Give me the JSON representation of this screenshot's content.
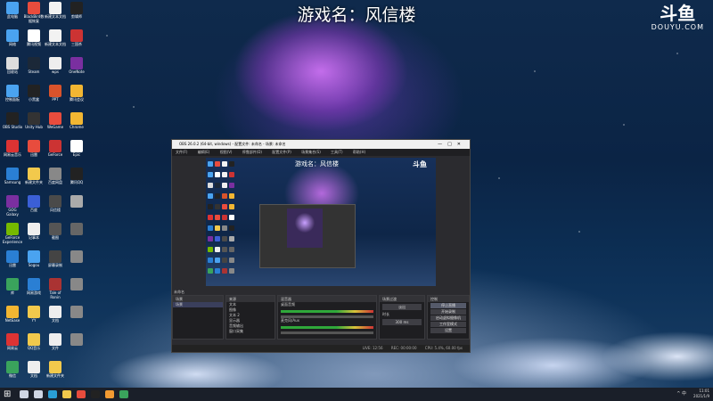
{
  "overlay": {
    "title": "游戏名：风信楼"
  },
  "brand": {
    "logo": "斗鱼",
    "sub": "DOUYU.COM"
  },
  "desktop_icons": [
    {
      "label": "此电脑",
      "icon": "computer-icon",
      "color": "#4aa3f0"
    },
    {
      "label": "BlackBird数据恢复",
      "icon": "app-icon",
      "color": "#e84c3d"
    },
    {
      "label": "新建文本文档",
      "icon": "document-icon",
      "color": "#f2f2f2"
    },
    {
      "label": "剪辑师",
      "icon": "app-icon",
      "color": "#222"
    },
    {
      "label": "网络",
      "icon": "network-icon",
      "color": "#4aa3f0"
    },
    {
      "label": "腾讯视频",
      "icon": "app-icon",
      "color": "#fff"
    },
    {
      "label": "新建文本文档",
      "icon": "document-icon",
      "color": "#f2f2f2"
    },
    {
      "label": "三国杀",
      "icon": "app-icon",
      "color": "#c33"
    },
    {
      "label": "回收站",
      "icon": "recycle-bin-icon",
      "color": "#ddd"
    },
    {
      "label": "Steam",
      "icon": "steam-icon",
      "color": "#1b2838"
    },
    {
      "label": "wps",
      "icon": "document-icon",
      "color": "#eee"
    },
    {
      "label": "OneNote",
      "icon": "app-icon",
      "color": "#7a2fa0"
    },
    {
      "label": "控制面板",
      "icon": "settings-icon",
      "color": "#4aa3f0"
    },
    {
      "label": "小黑盒",
      "icon": "app-icon",
      "color": "#222"
    },
    {
      "label": "PPT",
      "icon": "app-icon",
      "color": "#d9532b"
    },
    {
      "label": "腾讯会议",
      "icon": "app-icon",
      "color": "#f2b632"
    },
    {
      "label": "OBS Studio",
      "icon": "obs-icon",
      "color": "#222"
    },
    {
      "label": "Unity Hub",
      "icon": "app-icon",
      "color": "#333"
    },
    {
      "label": "WeGame",
      "icon": "app-icon",
      "color": "#e84c3d"
    },
    {
      "label": "Chrome",
      "icon": "chrome-icon",
      "color": "#f2b632"
    },
    {
      "label": "网易云音乐",
      "icon": "app-icon",
      "color": "#d33"
    },
    {
      "label": "迅雷",
      "icon": "app-icon",
      "color": "#e84c3d"
    },
    {
      "label": "GeForce",
      "icon": "app-icon",
      "color": "#c33"
    },
    {
      "label": "Epic",
      "icon": "app-icon",
      "color": "#fff"
    },
    {
      "label": "Samsung",
      "icon": "app-icon",
      "color": "#2a7fd4"
    },
    {
      "label": "新建文件夹",
      "icon": "folder-icon",
      "color": "#f2c94c"
    },
    {
      "label": "百度网盘",
      "icon": "app-icon",
      "color": "#888"
    },
    {
      "label": "腾讯QQ",
      "icon": "qq-icon",
      "color": "#222"
    },
    {
      "label": "GOG Galaxy",
      "icon": "app-icon",
      "color": "#7a2fa0"
    },
    {
      "label": "百度",
      "icon": "app-icon",
      "color": "#3b5fd6"
    },
    {
      "label": "风信楼",
      "icon": "game-icon",
      "color": "#4a4a4a"
    },
    {
      "label": "",
      "icon": "app-icon",
      "color": "#aaa"
    },
    {
      "label": "GeForce Experience",
      "icon": "app-icon",
      "color": "#76b900"
    },
    {
      "label": "记事本",
      "icon": "document-icon",
      "color": "#eee"
    },
    {
      "label": "截图",
      "icon": "app-icon",
      "color": "#555"
    },
    {
      "label": "",
      "icon": "app-icon",
      "color": "#666"
    },
    {
      "label": "迅雷",
      "icon": "app-icon",
      "color": "#2a7fd4"
    },
    {
      "label": "Sogou",
      "icon": "app-icon",
      "color": "#4aa3f0"
    },
    {
      "label": "屏幕录制",
      "icon": "app-icon",
      "color": "#444"
    },
    {
      "label": "",
      "icon": "app-icon",
      "color": "#888"
    },
    {
      "label": "库",
      "icon": "app-icon",
      "color": "#3aa35c"
    },
    {
      "label": "网易游戏",
      "icon": "app-icon",
      "color": "#2a7fd4"
    },
    {
      "label": "Tale of Ronin",
      "icon": "game-icon",
      "color": "#a33"
    },
    {
      "label": "",
      "icon": "app-icon",
      "color": "#888"
    },
    {
      "label": "NetEase",
      "icon": "app-icon",
      "color": "#f2b632"
    },
    {
      "label": "YY",
      "icon": "app-icon",
      "color": "#f2c94c"
    },
    {
      "label": "文档",
      "icon": "document-icon",
      "color": "#eee"
    },
    {
      "label": "",
      "icon": "app-icon",
      "color": "#888"
    },
    {
      "label": "网易云",
      "icon": "app-icon",
      "color": "#d33"
    },
    {
      "label": "QQ音乐",
      "icon": "app-icon",
      "color": "#f2c94c"
    },
    {
      "label": "文件",
      "icon": "document-icon",
      "color": "#eee"
    },
    {
      "label": "",
      "icon": "app-icon",
      "color": "#888"
    },
    {
      "label": "微信",
      "icon": "wechat-icon",
      "color": "#3aa35c"
    },
    {
      "label": "文档",
      "icon": "document-icon",
      "color": "#eee"
    },
    {
      "label": "新建文件夹",
      "icon": "folder-icon",
      "color": "#f2c94c"
    }
  ],
  "obs": {
    "titlebar": "OBS 26.0.2 (64-bit, windows) - 配置文件: 未命名 - 场景: 未命名",
    "menu": [
      "文件(F)",
      "编辑(E)",
      "视图(V)",
      "停靠部件(D)",
      "配置文件(P)",
      "场景集合(S)",
      "工具(T)",
      "帮助(H)"
    ],
    "preview_title": "游戏名：风信楼",
    "preview_logo": "斗鱼",
    "scene_label": "未命名",
    "scenes_header": "场景",
    "scenes": [
      "场景"
    ],
    "sources_header": "来源",
    "sources": [
      "文本",
      "图像",
      "文本 2",
      "显示器",
      "音频输出",
      "窗口采集"
    ],
    "mixer_header": "混音器",
    "mixer": [
      "桌面音频",
      "麦克风/Aux"
    ],
    "transition_header": "场景过渡",
    "transition": "淡出",
    "duration_label": "时长",
    "duration": "300 ms",
    "controls_header": "控制",
    "controls": [
      "停止直播",
      "开始录制",
      "启动虚拟摄像机",
      "工作室模式",
      "设置",
      "退出"
    ],
    "status": [
      "LIVE: 12:56",
      "REC: 00:00:00",
      "CPU: 5.4%, 60.00 fps"
    ]
  },
  "taskbar": {
    "start": "⊞",
    "apps": [
      {
        "icon": "search-icon",
        "color": "#cfd6e4"
      },
      {
        "icon": "task-view-icon",
        "color": "#cfd6e4"
      },
      {
        "icon": "edge-icon",
        "color": "#2a9fd6"
      },
      {
        "icon": "folder-icon",
        "color": "#f2c94c"
      },
      {
        "icon": "chrome-icon",
        "color": "#e84c3d"
      },
      {
        "icon": "obs-icon",
        "color": "#222"
      },
      {
        "icon": "app-icon",
        "color": "#f29a32"
      },
      {
        "icon": "wechat-icon",
        "color": "#3aa35c"
      }
    ],
    "tray": "^ 中",
    "time": "11:01",
    "date": "2021/1/9"
  }
}
